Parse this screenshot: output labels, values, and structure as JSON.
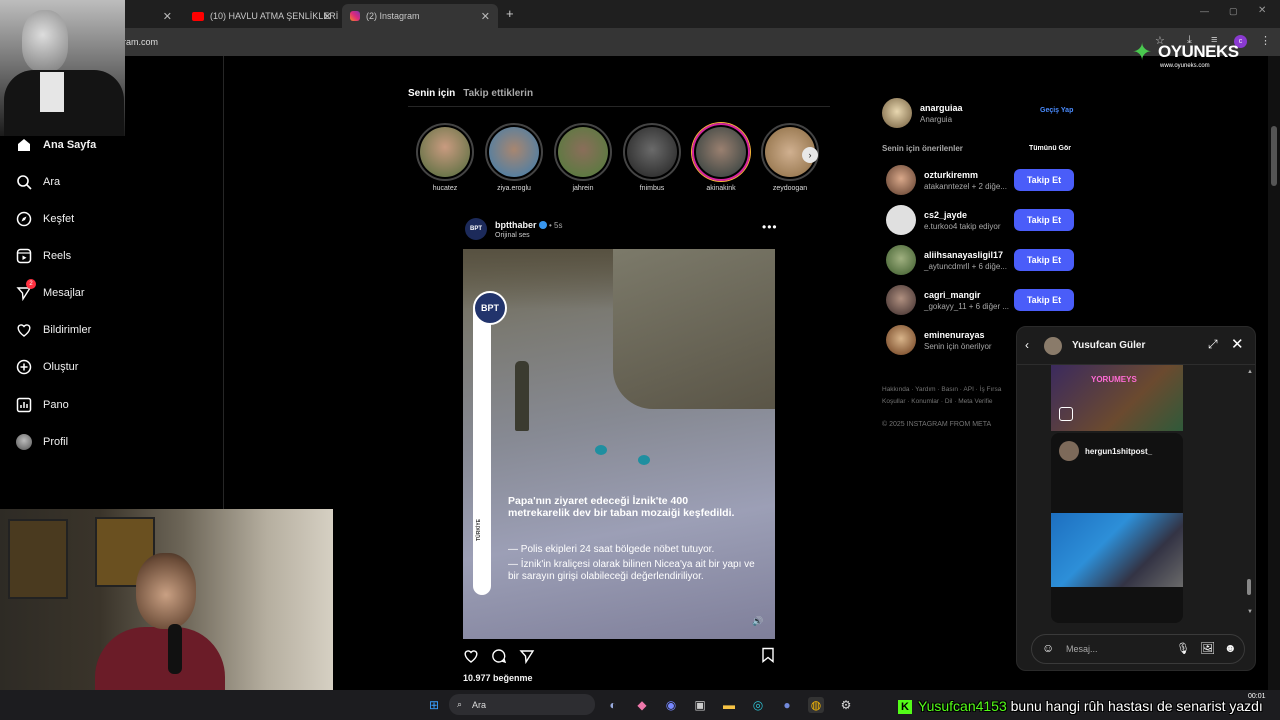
{
  "browser": {
    "tabs": [
      {
        "title": "(10) HAVLU ATMA ŞENLİKLERİ",
        "icon": "youtube-icon"
      },
      {
        "title": "(2) Instagram",
        "icon": "instagram-icon"
      }
    ],
    "new_tab": "+",
    "address": "gram.com"
  },
  "sidebar": {
    "items": [
      {
        "label": "Ana Sayfa",
        "icon": "home-icon"
      },
      {
        "label": "Ara",
        "icon": "search-icon"
      },
      {
        "label": "Keşfet",
        "icon": "compass-icon"
      },
      {
        "label": "Reels",
        "icon": "reels-icon"
      },
      {
        "label": "Mesajlar",
        "icon": "messenger-icon",
        "badge": "2"
      },
      {
        "label": "Bildirimler",
        "icon": "heart-icon"
      },
      {
        "label": "Oluştur",
        "icon": "plus-square-icon"
      },
      {
        "label": "Pano",
        "icon": "dashboard-icon"
      },
      {
        "label": "Profil",
        "icon": "profile-icon"
      }
    ]
  },
  "feed": {
    "tab_for_you": "Senin için",
    "tab_following": "Takip ettiklerin",
    "stories": [
      "hucatez",
      "ziya.eroglu",
      "jahrein",
      "fnimbus",
      "akinakink",
      "zeydoogan"
    ],
    "post": {
      "user": "bptthaber",
      "time": "5s",
      "audio": "Orijinal ses",
      "logo_text": "BPT",
      "region_tag": "TÜRKİYE",
      "headline": "Papa'nın ziyaret edeceği İznik'te 400 metrekarelik dev bir taban mozaiği keşfedildi.",
      "bullet1": "— Polis ekipleri 24 saat bölgede nöbet tutuyor.",
      "bullet2": "— İznik'in kraliçesi olarak bilinen Nicea'ya ait bir yapı ve bir sarayın girişi olabileceği değerlendiriliyor.",
      "likes": "10.977 beğenme"
    }
  },
  "right": {
    "me": {
      "username": "anarguiaa",
      "name": "Anarguia",
      "switch": "Geçiş Yap"
    },
    "suggestions_title": "Senin için önerilenler",
    "see_all": "Tümünü Gör",
    "suggestions": [
      {
        "username": "ozturkiremm",
        "sub": "atakanntezel + 2 diğe...",
        "button": "Takip Et"
      },
      {
        "username": "cs2_jayde",
        "sub": "e.turkoo4 takip ediyor",
        "button": "Takip Et"
      },
      {
        "username": "aliihsanayasligil17",
        "sub": "_aytuncdmrll + 6 diğe...",
        "button": "Takip Et"
      },
      {
        "username": "cagri_mangir",
        "sub": "_gokayy_11 + 6 diğer ...",
        "button": "Takip Et"
      },
      {
        "username": "eminenurayas",
        "sub": "Senin için önerilyor"
      }
    ],
    "footer": "Hakkında · Yardım · Basın · API · İş Fırsa Koşullar · Konumlar · Dil · Meta Verifie",
    "copyright": "© 2025 INSTAGRAM FROM META"
  },
  "chat": {
    "name": "Yusufcan Güler",
    "card1_label": "YORUMEYS",
    "card2_user": "hergun1shitpost_",
    "placeholder": "Mesaj..."
  },
  "overlay": {
    "logo_text": "OYUNEKS",
    "logo_url": "www.oyuneks.com",
    "ticker_user": "Yusufcan4153",
    "ticker_msg": "bunu hangi rûh hastası de senarist yazdı",
    "clock": "00:01"
  },
  "taskbar": {
    "search": "Ara"
  }
}
